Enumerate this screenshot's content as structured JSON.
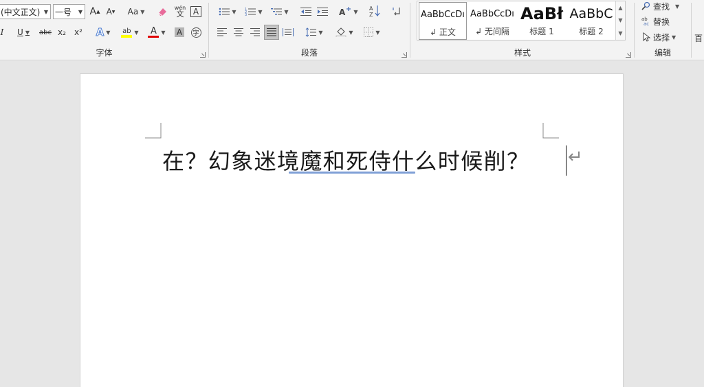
{
  "font_group": {
    "label": "字体",
    "font_name": "(中文正文)",
    "font_size": "一号",
    "grow_label": "A",
    "shrink_label": "A",
    "case_label": "Aa",
    "pinyin_label": "wén",
    "border_label": "A",
    "italic_label": "I",
    "underline_label": "U",
    "strike_label": "abc",
    "subscript_label": "x₂",
    "superscript_label": "x²",
    "effects_label": "A",
    "highlight_label": "ab",
    "color_label": "A",
    "shading_label": "A",
    "enclose_label": "字"
  },
  "paragraph_group": {
    "label": "段落"
  },
  "styles_group": {
    "label": "样式",
    "items": [
      {
        "sample": "AaBbCcDı",
        "name": "↲ 正文"
      },
      {
        "sample": "AaBbCcDı",
        "name": "↲ 无间隔"
      },
      {
        "sample": "AaBł",
        "name": "标题 1"
      },
      {
        "sample": "AaBbC",
        "name": "标题 2"
      }
    ]
  },
  "editing_group": {
    "label": "编辑",
    "find_label": "查找",
    "replace_label": "替换",
    "select_label": "选择",
    "extra_label": "百"
  },
  "document": {
    "text": "在？幻象迷境魔和死侍什么时候削？",
    "para_mark": "↵"
  },
  "colors": {
    "highlight": "#ffff00",
    "font_color": "#e00000",
    "spell_underline": "#7f9fd6"
  }
}
